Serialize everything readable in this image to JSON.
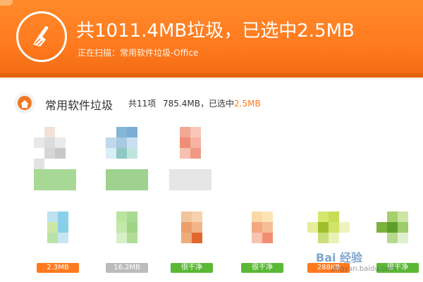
{
  "header": {
    "title": "共1011.4MB垃圾，已选中2.5MB",
    "scanning": "正在扫描：常用软件垃圾-Office",
    "accent": "#ff7a1e"
  },
  "category": {
    "icon": "broom-house-icon",
    "title": "常用软件垃圾",
    "count": "共11项",
    "size": "785.4MB，",
    "selected_label": "已选中",
    "selected_value": "2.5MB"
  },
  "items_row2": [
    {
      "label": "2.3MB",
      "style": "orange"
    },
    {
      "label": "16.2MB",
      "style": "gray"
    },
    {
      "label": "很干净",
      "style": "green"
    },
    {
      "label": "很干净",
      "style": "green"
    },
    {
      "label": "288KB",
      "style": "orange"
    },
    {
      "label": "很干净",
      "style": "green"
    }
  ],
  "watermark": {
    "text": "Bai 经验",
    "sub": "jingyan.baidu.com"
  }
}
